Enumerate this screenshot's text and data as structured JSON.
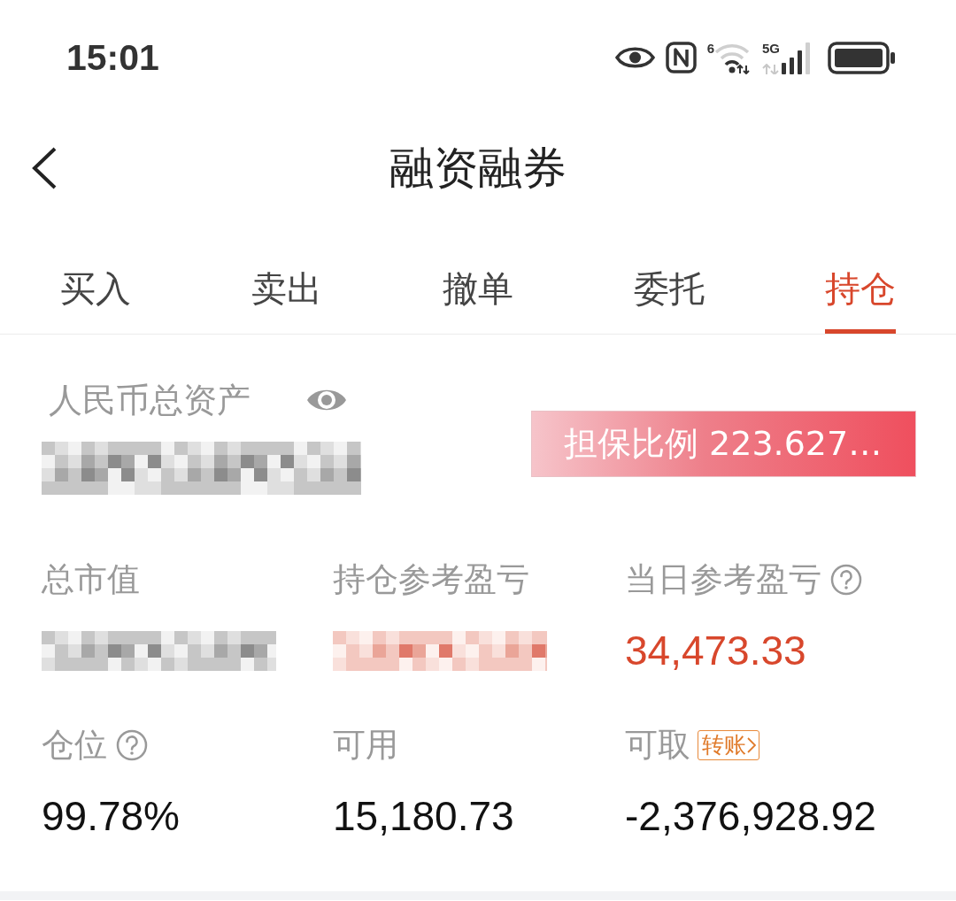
{
  "status_bar": {
    "time": "15:01",
    "wifi_label": "6",
    "network_label": "5G"
  },
  "header": {
    "title": "融资融券"
  },
  "tabs": [
    {
      "label": "买入",
      "selected": false
    },
    {
      "label": "卖出",
      "selected": false
    },
    {
      "label": "撤单",
      "selected": false
    },
    {
      "label": "委托",
      "selected": false
    },
    {
      "label": "持仓",
      "selected": true
    }
  ],
  "summary": {
    "label": "人民币总资产",
    "value": {
      "kind": "redacted",
      "positive": false
    },
    "ratio_badge": "担保比例 223.627…"
  },
  "stats": [
    {
      "label": "总市值",
      "help": false,
      "value": {
        "kind": "redacted",
        "positive": false
      }
    },
    {
      "label": "持仓参考盈亏",
      "help": false,
      "value": {
        "kind": "redacted",
        "positive": true
      }
    },
    {
      "label": "当日参考盈亏",
      "help": true,
      "value": {
        "kind": "text",
        "text": "34,473.33",
        "positive": true
      }
    },
    {
      "label": "仓位",
      "help": true,
      "value": {
        "kind": "text",
        "text": "99.78%",
        "positive": false
      }
    },
    {
      "label": "可用",
      "help": false,
      "value": {
        "kind": "text",
        "text": "15,180.73",
        "positive": false
      }
    },
    {
      "label": "可取",
      "help": false,
      "action": "转账",
      "value": {
        "kind": "text",
        "text": "-2,376,928.92",
        "positive": false
      }
    }
  ]
}
